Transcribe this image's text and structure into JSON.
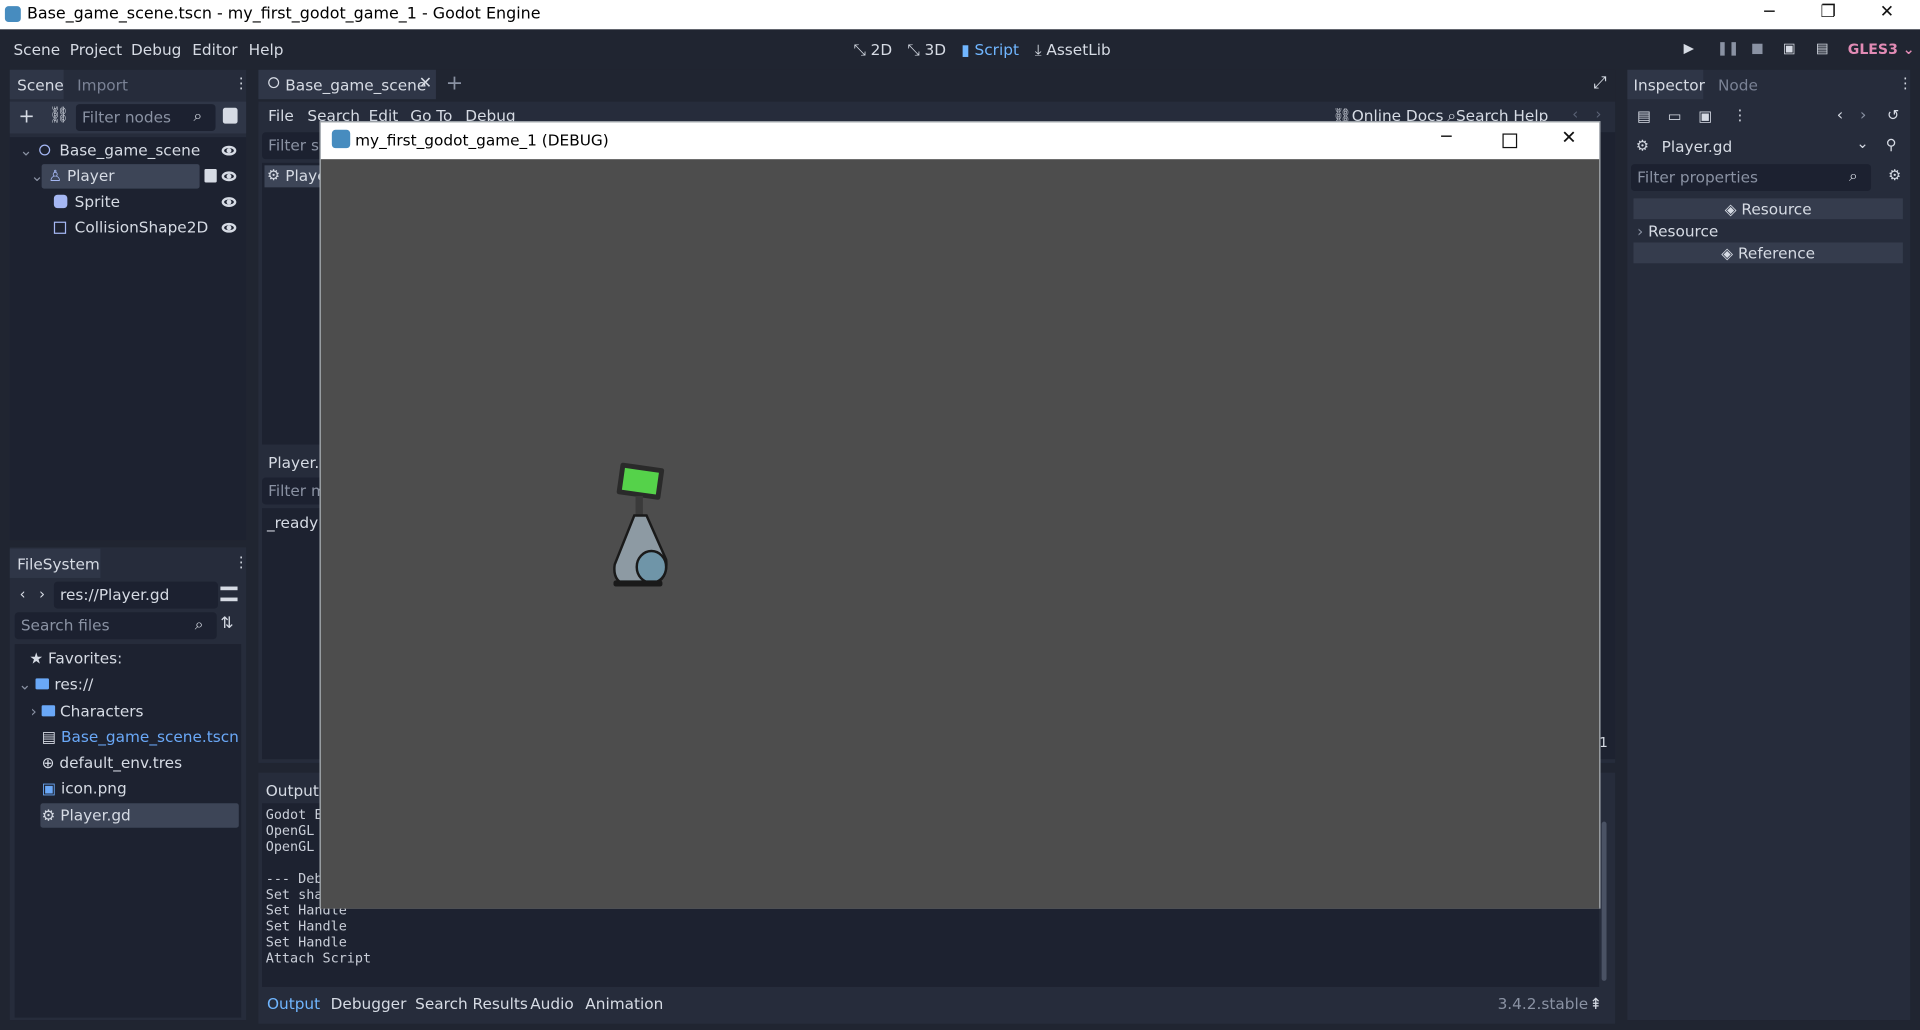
{
  "window": {
    "title": "Base_game_scene.tscn - my_first_godot_game_1 - Godot Engine",
    "minimize": "─",
    "restore": "❐",
    "close": "✕"
  },
  "menu": [
    "Scene",
    "Project",
    "Debug",
    "Editor",
    "Help"
  ],
  "workspaces": {
    "w2d": "2D",
    "w3d": "3D",
    "script": "Script",
    "assetlib": "AssetLib"
  },
  "renderer": "GLES3",
  "scene_dock": {
    "tab_scene": "Scene",
    "tab_import": "Import",
    "filter_placeholder": "Filter nodes",
    "nodes": [
      {
        "label": "Base_game_scene",
        "icon": "node2d-circle-icon"
      },
      {
        "label": "Player",
        "icon": "kinematic-body-icon"
      },
      {
        "label": "Sprite",
        "icon": "sprite-icon"
      },
      {
        "label": "CollisionShape2D",
        "icon": "collision-shape-icon"
      }
    ]
  },
  "filesystem": {
    "title": "FileSystem",
    "path": "res://Player.gd",
    "search_placeholder": "Search files",
    "favorites": "Favorites:",
    "root": "res://",
    "items": [
      {
        "label": "Characters",
        "icon": "folder-icon",
        "color": "#d6dbe4"
      },
      {
        "label": "Base_game_scene.tscn",
        "icon": "scene-file-icon",
        "color": "#6aa8f7"
      },
      {
        "label": "default_env.tres",
        "icon": "globe-icon",
        "color": "#d6dbe4"
      },
      {
        "label": "icon.png",
        "icon": "image-icon",
        "color": "#d6dbe4"
      },
      {
        "label": "Player.gd",
        "icon": "gear-icon",
        "color": "#d6dbe4"
      }
    ]
  },
  "editor": {
    "scene_tab": "Base_game_scene",
    "script_menu": [
      "File",
      "Search",
      "Edit",
      "Go To",
      "Debug"
    ],
    "online_docs": "Online Docs",
    "search_help": "Search Help",
    "filter_scripts": "Filter sc",
    "script_item": "Playe",
    "player_gd": "Player.g",
    "filter_methods": "Filter m",
    "method": "_ready",
    "line_number": "1"
  },
  "output": {
    "label": "Output:",
    "lines": [
      "Godot E",
      "OpenGL",
      "OpenGL",
      "",
      "--- Deb",
      "Set sha",
      "Set Handle",
      "Set Handle",
      "Set Handle",
      "Attach Script"
    ]
  },
  "bottom_tabs": [
    "Output",
    "Debugger",
    "Search Results",
    "Audio",
    "Animation"
  ],
  "version": "3.4.2.stable",
  "inspector": {
    "tab_inspector": "Inspector",
    "tab_node": "Node",
    "object": "Player.gd",
    "filter_placeholder": "Filter properties",
    "section_resource": "Resource",
    "resource_row": "Resource",
    "section_reference": "Reference"
  },
  "debug_window": {
    "title": "my_first_godot_game_1 (DEBUG)",
    "bg_color": "#4d4d4d"
  },
  "colors": {
    "accent": "#70b6ff",
    "renderer": "#e28bb5",
    "selected": "#3d4557"
  }
}
